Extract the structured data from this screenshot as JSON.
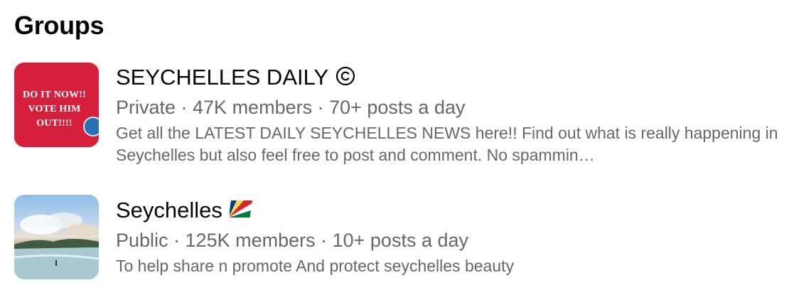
{
  "section": {
    "title": "Groups"
  },
  "groups": [
    {
      "name": "SEYCHELLES DAILY",
      "name_icon": "copyright-circle-icon",
      "meta": "Private · 47K members · 70+ posts a day",
      "description": "Get all the LATEST DAILY SEYCHELLES NEWS here!! Find out what is really happening in Seychelles but also feel free to post and comment. No spammin…",
      "thumbnail": {
        "line1": "DO IT NOW!!",
        "line2": "VOTE HIM OUT!!!!",
        "background": "#d51f3b"
      }
    },
    {
      "name": "Seychelles",
      "name_icon": "seychelles-flag-icon",
      "meta": "Public · 125K members · 10+ posts a day",
      "description": "To help share n promote And protect seychelles beauty",
      "thumbnail": {
        "scene": "island-beach-photo"
      }
    }
  ],
  "colors": {
    "primary_text": "#050505",
    "secondary_text": "#65676b"
  }
}
